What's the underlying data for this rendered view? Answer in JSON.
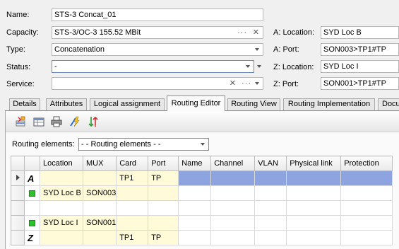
{
  "form": {
    "name_label": "Name:",
    "name_value": "STS-3 Concat_01",
    "capacity_label": "Capacity:",
    "capacity_value": "STS-3/OC-3 155.52 MBit",
    "type_label": "Type:",
    "type_value": "Concatenation",
    "status_label": "Status:",
    "status_value": "-",
    "service_label": "Service:",
    "service_value": "",
    "a_location_label": "A: Location:",
    "a_location_value": "SYD Loc B",
    "a_port_label": "A: Port:",
    "a_port_value": "SON003>TP1#TP",
    "z_location_label": "Z: Location:",
    "z_location_value": "SYD Loc I",
    "z_port_label": "Z: Port:",
    "z_port_value": "SON001>TP1#TP",
    "ellipsis": "···",
    "clear": "✕"
  },
  "tabs": [
    "Details",
    "Attributes",
    "Logical assignment",
    "Routing Editor",
    "Routing View",
    "Routing Implementation",
    "Docu"
  ],
  "active_tab": "Routing Editor",
  "toolbar": {
    "icons": [
      "insert-element-icon",
      "table-icon",
      "print-icon",
      "auto-route-icon",
      "sort-icon"
    ]
  },
  "routing": {
    "label": "Routing elements:",
    "select_value": "- - Routing elements - -"
  },
  "grid": {
    "columns": [
      "Location",
      "MUX",
      "Card",
      "Port",
      "Name",
      "Channel",
      "VLAN",
      "Physical link",
      "Protection"
    ],
    "rows": [
      {
        "marker": "A",
        "location": "",
        "mux": "",
        "card": "TP1",
        "port": "TP"
      },
      {
        "marker": "",
        "location": "SYD Loc B",
        "mux": "SON003",
        "card": "",
        "port": ""
      },
      {
        "marker": "",
        "location": "",
        "mux": "",
        "card": "",
        "port": ""
      },
      {
        "marker": "",
        "location": "SYD Loc I",
        "mux": "SON001",
        "card": "",
        "port": ""
      },
      {
        "marker": "Z",
        "location": "",
        "mux": "",
        "card": "TP1",
        "port": "TP"
      }
    ]
  },
  "colors": {
    "selection": "#8ea4e0",
    "highlight_cells": "#fffbd9",
    "element_square": "#2fbf2f"
  }
}
